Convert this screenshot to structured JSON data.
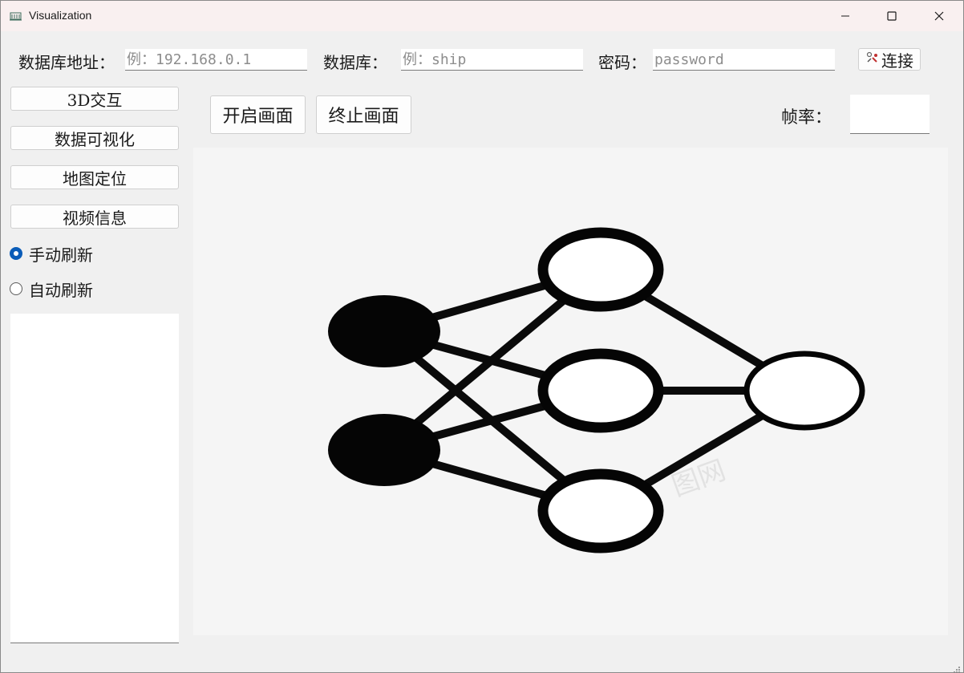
{
  "window": {
    "title": "Visualization"
  },
  "connection": {
    "db_address_label": "数据库地址：",
    "db_address_placeholder": "例：192.168.0.1",
    "db_name_label": "数据库：",
    "db_name_placeholder": "例：ship",
    "password_label": "密码：",
    "password_placeholder": "password",
    "connect_label": "连接"
  },
  "sidebar": {
    "items": [
      {
        "label": "3D交互"
      },
      {
        "label": "数据可视化"
      },
      {
        "label": "地图定位"
      },
      {
        "label": "视频信息"
      }
    ],
    "refresh_options": [
      {
        "label": "手动刷新",
        "checked": true
      },
      {
        "label": "自动刷新",
        "checked": false
      }
    ]
  },
  "controls": {
    "start_label": "开启画面",
    "stop_label": "终止画面",
    "fps_label": "帧率："
  },
  "display": {
    "image": "neural-network-diagram",
    "watermark": "图网"
  },
  "colors": {
    "accent": "#0a5cb8",
    "window_bg": "#f0f0f0",
    "titlebar_bg": "#f9f0f0",
    "display_bg": "#f5f5f5"
  }
}
